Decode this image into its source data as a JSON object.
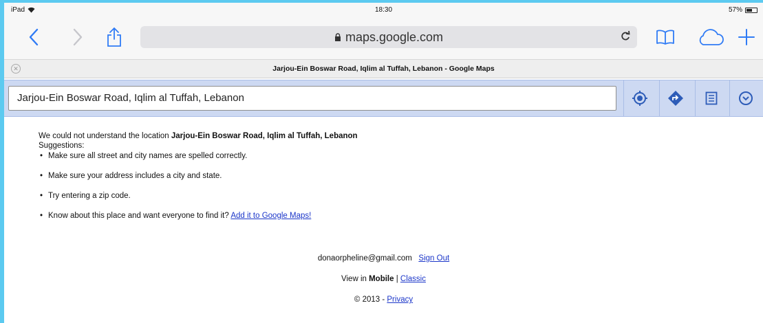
{
  "status_bar": {
    "device": "iPad",
    "time": "18:30",
    "battery": "57%",
    "battery_level": 0.57
  },
  "toolbar": {
    "url": "maps.google.com",
    "icons": [
      "back-icon",
      "forward-icon",
      "share-icon",
      "lock-icon",
      "reload-icon",
      "bookmarks-icon",
      "icloud-tabs-icon",
      "new-tab-icon"
    ]
  },
  "tab": {
    "title": "Jarjou-Ein Boswar Road, Iqlim al Tuffah, Lebanon - Google Maps"
  },
  "search": {
    "value": "Jarjou-Ein Boswar Road, Iqlim al Tuffah, Lebanon",
    "buttons": [
      "my-location-icon",
      "directions-icon",
      "list-icon",
      "menu-icon"
    ]
  },
  "message": {
    "prefix": "We could not understand the location ",
    "location": "Jarjou-Ein Boswar Road, Iqlim al Tuffah, Lebanon",
    "suggestions_label": "Suggestions:",
    "items": [
      "Make sure all street and city names are spelled correctly.",
      "Make sure your address includes a city and state.",
      "Try entering a zip code.",
      "Know about this place and want everyone to find it? "
    ],
    "add_link": "Add it to Google Maps!"
  },
  "footer": {
    "email": "donaorpheline@gmail.com",
    "sign_out": "Sign Out",
    "view_in": "View in ",
    "mobile": "Mobile",
    "separator": " | ",
    "classic": "Classic",
    "copyright": "© 2013 - ",
    "privacy": "Privacy"
  },
  "colors": {
    "accent": "#2f7bf5",
    "maps_header": "#cdd9f2",
    "link": "#1a35c9",
    "frame": "#5ccaf0"
  }
}
